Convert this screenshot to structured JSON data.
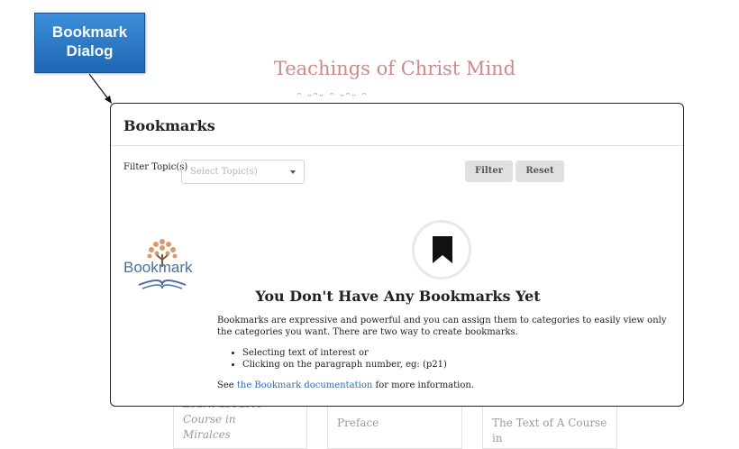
{
  "callout": {
    "line1": "Bookmark",
    "line2": "Dialog"
  },
  "background": {
    "site_title": "Teachings of Christ Mind",
    "cards": [
      {
        "partial": "Learn about A Course in",
        "title": "Miralces"
      },
      {
        "partial": "",
        "title": "Preface"
      },
      {
        "partial": "",
        "title": "The Text of A Course in"
      }
    ]
  },
  "dialog": {
    "title": "Bookmarks",
    "filter_label": "Filter Topic(s)",
    "filter_placeholder": "Select Topic(s)",
    "filter_button": "Filter",
    "reset_button": "Reset",
    "logo_text": "Bookmark",
    "empty_title": "You Don't Have Any Bookmarks Yet",
    "description": "Bookmarks are expressive and powerful and you can assign them to categories to easily view only the categories you want. There are two way to create bookmarks.",
    "ways": [
      "Selecting text of interest or",
      "Clicking on the paragraph number, eg: (p21)"
    ],
    "see_prefix": "See",
    "see_link": "the Bookmark documentation",
    "see_suffix": "for more information."
  }
}
